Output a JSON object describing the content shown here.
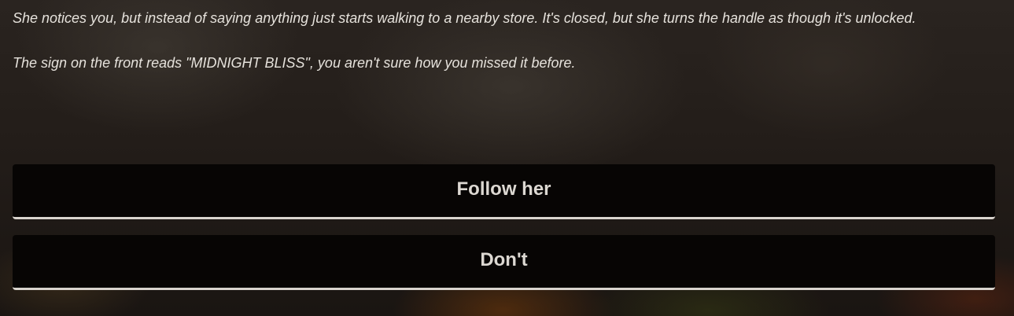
{
  "story": {
    "paragraph_1": "She notices you, but instead of saying anything just starts walking to a nearby store. It's closed, but she turns the handle as though it's unlocked.",
    "paragraph_2": "The sign on the front reads \"MIDNIGHT BLISS\", you aren't sure how you missed it before."
  },
  "choices": [
    {
      "label": "Follow her"
    },
    {
      "label": "Don't"
    }
  ],
  "colors": {
    "button_background": "#070504",
    "button_underline": "#d9d4ce",
    "text": "#e6e2dc"
  }
}
